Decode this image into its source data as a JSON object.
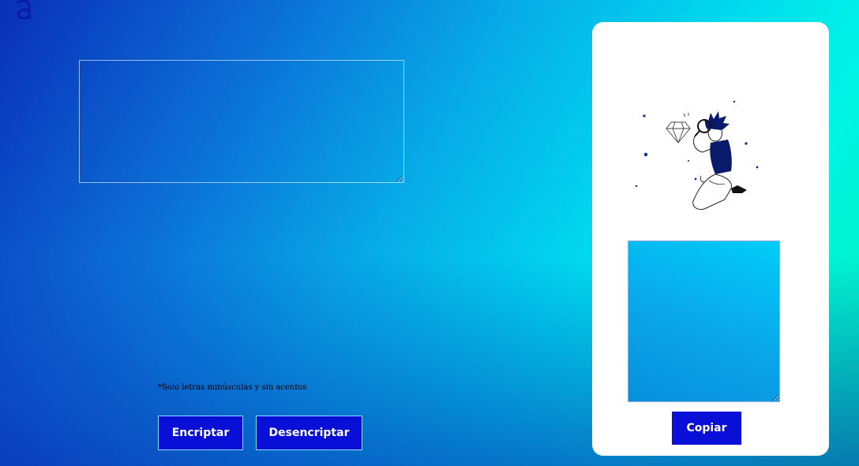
{
  "app": {
    "logo_icon": "alura-logo-icon"
  },
  "input": {
    "value": "",
    "placeholder": ""
  },
  "hint": {
    "text": "*Solo letras minúsculas y sin acentos"
  },
  "buttons": {
    "encrypt_label": "Encriptar",
    "decrypt_label": "Desencriptar",
    "copy_label": "Copiar"
  },
  "output": {
    "value": "",
    "placeholder": "",
    "illustration_icon": "person-with-magnifier-illustration"
  },
  "colors": {
    "button": "#0a0fd8",
    "panel": "#ffffff",
    "gradient_start": "#0a2fb8",
    "gradient_end": "#02f2b0"
  }
}
